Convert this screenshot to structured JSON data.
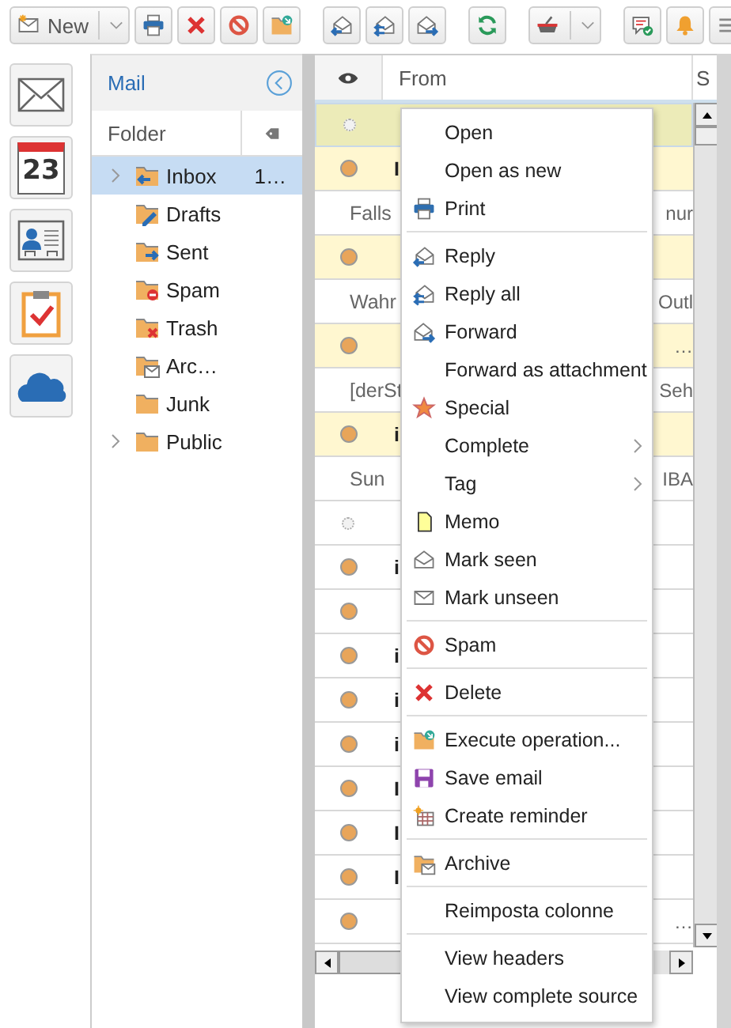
{
  "toolbar": {
    "groups": [
      [
        {
          "kind": "new",
          "label": "New",
          "dropdown": true
        },
        {
          "kind": "print"
        },
        {
          "kind": "delete"
        },
        {
          "kind": "spam"
        },
        {
          "kind": "execute"
        }
      ],
      [
        {
          "kind": "reply"
        },
        {
          "kind": "reply_all"
        },
        {
          "kind": "forward"
        }
      ],
      [
        {
          "kind": "refresh"
        }
      ],
      [
        {
          "kind": "basket",
          "dropdown": true
        }
      ],
      [
        {
          "kind": "chat"
        },
        {
          "kind": "bell"
        },
        {
          "kind": "menu"
        }
      ]
    ]
  },
  "app_rail": [
    {
      "kind": "mail"
    },
    {
      "kind": "calendar",
      "text": "23"
    },
    {
      "kind": "contacts"
    },
    {
      "kind": "tasks"
    },
    {
      "kind": "cloud"
    }
  ],
  "folder_panel": {
    "title": "Mail",
    "column": "Folder",
    "folders": [
      {
        "kind": "inbox",
        "label": "Inbox",
        "count": "1…",
        "expandable": true,
        "selected": true
      },
      {
        "kind": "drafts",
        "label": "Drafts",
        "expandable": false,
        "selected": false
      },
      {
        "kind": "sent",
        "label": "Sent",
        "expandable": false,
        "selected": false
      },
      {
        "kind": "spam",
        "label": "Spam",
        "expandable": false,
        "selected": false
      },
      {
        "kind": "trash",
        "label": "Trash",
        "expandable": false,
        "selected": false
      },
      {
        "kind": "archive",
        "label": "Arc…",
        "expandable": false,
        "selected": false
      },
      {
        "kind": "plain",
        "label": "Junk",
        "expandable": false,
        "selected": false
      },
      {
        "kind": "plain",
        "label": "Public",
        "expandable": true,
        "selected": false
      }
    ]
  },
  "message_list": {
    "columns": [
      "From",
      "S"
    ],
    "rows": [
      {
        "kind": "message",
        "unread": false,
        "highlighted": true,
        "selected": true
      },
      {
        "kind": "message",
        "from": "I",
        "unread": true,
        "highlighted": true,
        "selected": false
      },
      {
        "kind": "preview",
        "text": "Falls",
        "text_right": "nur"
      },
      {
        "kind": "message",
        "unread": true,
        "highlighted": true,
        "selected": false
      },
      {
        "kind": "preview",
        "text": "Wahr",
        "text_right": "Outl"
      },
      {
        "kind": "message",
        "text_right": "…",
        "unread": true,
        "highlighted": true,
        "selected": false
      },
      {
        "kind": "preview",
        "text": "[derSt",
        "text_right": "Seh"
      },
      {
        "kind": "message",
        "from": "i",
        "unread": true,
        "highlighted": true,
        "selected": false
      },
      {
        "kind": "preview",
        "text": "Sun",
        "text_right": "IBA"
      },
      {
        "kind": "message",
        "unread": false,
        "highlighted": false,
        "selected": false
      },
      {
        "kind": "message",
        "from": "i",
        "unread": true,
        "highlighted": false,
        "selected": false
      },
      {
        "kind": "message",
        "unread": true,
        "highlighted": false,
        "selected": false
      },
      {
        "kind": "message",
        "from": "i",
        "unread": true,
        "highlighted": false,
        "selected": false
      },
      {
        "kind": "message",
        "from": "i",
        "unread": true,
        "highlighted": false,
        "selected": false
      },
      {
        "kind": "message",
        "from": "i",
        "unread": true,
        "highlighted": false,
        "selected": false
      },
      {
        "kind": "message",
        "from": "I",
        "unread": true,
        "highlighted": false,
        "selected": false
      },
      {
        "kind": "message",
        "from": "I",
        "unread": true,
        "highlighted": false,
        "selected": false
      },
      {
        "kind": "message",
        "from": "I",
        "unread": true,
        "highlighted": false,
        "selected": false
      },
      {
        "kind": "message",
        "text_right": "…",
        "unread": true,
        "highlighted": false,
        "selected": false
      }
    ]
  },
  "context_menu": {
    "groups": [
      [
        {
          "kind": "plain",
          "label": "Open"
        },
        {
          "kind": "plain",
          "label": "Open as new"
        },
        {
          "kind": "print",
          "label": "Print"
        }
      ],
      [
        {
          "kind": "reply",
          "label": "Reply"
        },
        {
          "kind": "reply_all",
          "label": "Reply all"
        },
        {
          "kind": "forward",
          "label": "Forward"
        },
        {
          "kind": "plain",
          "label": "Forward as attachment"
        },
        {
          "kind": "star",
          "label": "Special"
        },
        {
          "kind": "plain",
          "label": "Complete",
          "submenu": true
        },
        {
          "kind": "plain",
          "label": "Tag",
          "submenu": true
        },
        {
          "kind": "memo",
          "label": "Memo"
        },
        {
          "kind": "mark_seen",
          "label": "Mark seen"
        },
        {
          "kind": "mark_unseen",
          "label": "Mark unseen"
        }
      ],
      [
        {
          "kind": "spam",
          "label": "Spam"
        }
      ],
      [
        {
          "kind": "delete",
          "label": "Delete"
        }
      ],
      [
        {
          "kind": "execute",
          "label": "Execute operation..."
        },
        {
          "kind": "save",
          "label": "Save email"
        },
        {
          "kind": "reminder",
          "label": "Create reminder"
        }
      ],
      [
        {
          "kind": "archive",
          "label": "Archive"
        }
      ],
      [
        {
          "kind": "plain",
          "label": "Reimposta colonne"
        }
      ],
      [
        {
          "kind": "plain",
          "label": "View headers"
        },
        {
          "kind": "plain",
          "label": "View complete source"
        }
      ]
    ]
  }
}
